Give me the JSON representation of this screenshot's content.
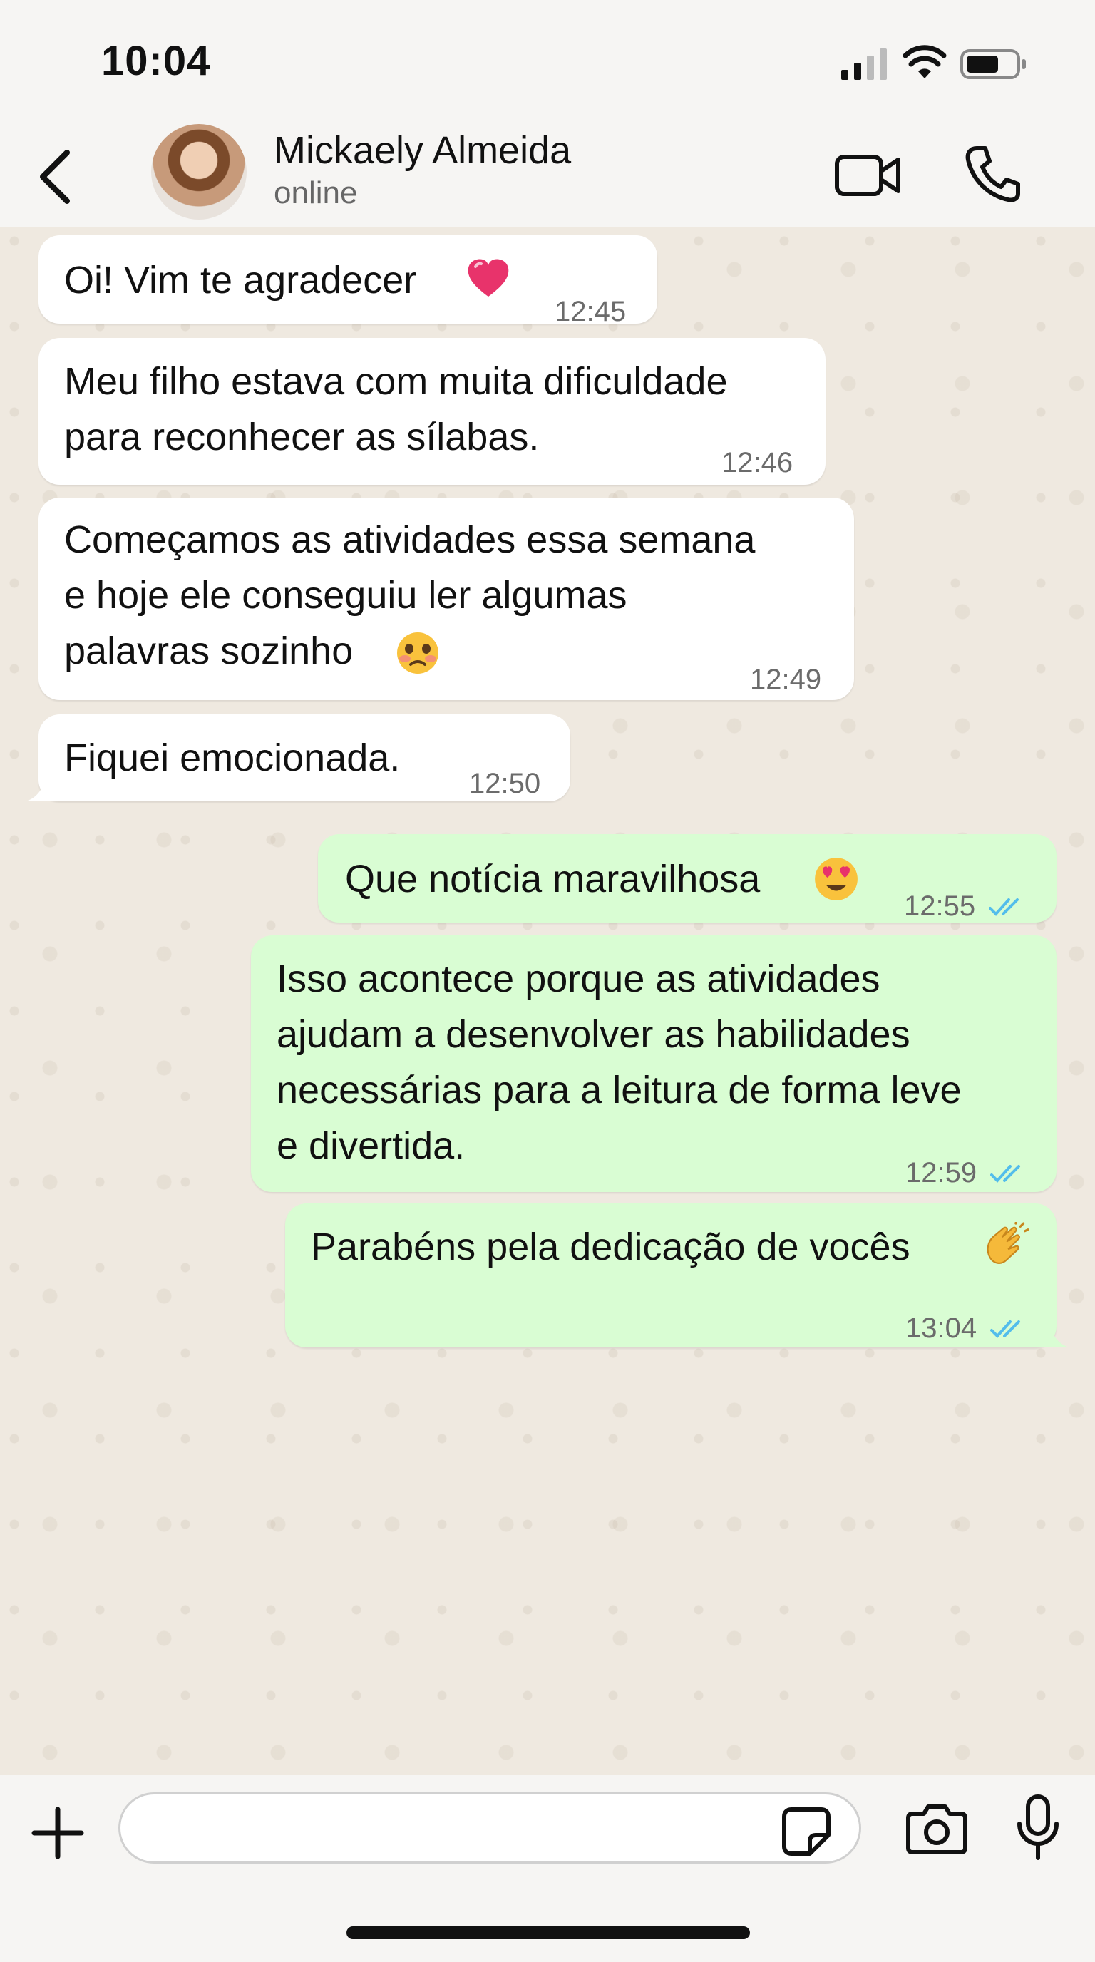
{
  "status_bar": {
    "time": "10:04"
  },
  "header": {
    "contact_name": "Mickaely Almeida",
    "contact_status": "online"
  },
  "messages": [
    {
      "direction": "incoming",
      "text": "Oi! Vim te agradecer",
      "emoji": "heart",
      "time": "12:45"
    },
    {
      "direction": "incoming",
      "text": "Meu filho estava com muita dificuldade\npara reconhecer as sílabas.",
      "time": "12:46"
    },
    {
      "direction": "incoming",
      "text": "Começamos as atividades essa semana\ne hoje ele conseguiu ler algumas\npalavras sozinho",
      "emoji": "face-holding-back-tears",
      "time": "12:49"
    },
    {
      "direction": "incoming",
      "text": "Fiquei emocionada.",
      "time": "12:50"
    },
    {
      "direction": "outgoing",
      "text": "Que notícia maravilhosa",
      "emoji": "heart-eyes",
      "time": "12:55",
      "status": "read"
    },
    {
      "direction": "outgoing",
      "text": "Isso acontece porque as atividades\najudam a desenvolver as habilidades\nnecessárias para a leitura de forma leve\ne divertida.",
      "time": "12:59",
      "status": "read"
    },
    {
      "direction": "outgoing",
      "text": "Parabéns pela dedicação de vocês",
      "emoji": "clapping-hands",
      "time": "13:04",
      "status": "read"
    }
  ],
  "input": {
    "placeholder": "",
    "value": ""
  },
  "colors": {
    "incoming_bubble": "#ffffff",
    "outgoing_bubble": "#d9fdd3",
    "read_ticks": "#53bdeb",
    "chat_background": "#efe9e0"
  },
  "icons": [
    "back-chevron-icon",
    "video-camera-icon",
    "phone-icon",
    "plus-icon",
    "sticker-icon",
    "camera-icon",
    "microphone-icon",
    "signal-icon",
    "wifi-icon",
    "battery-icon"
  ]
}
